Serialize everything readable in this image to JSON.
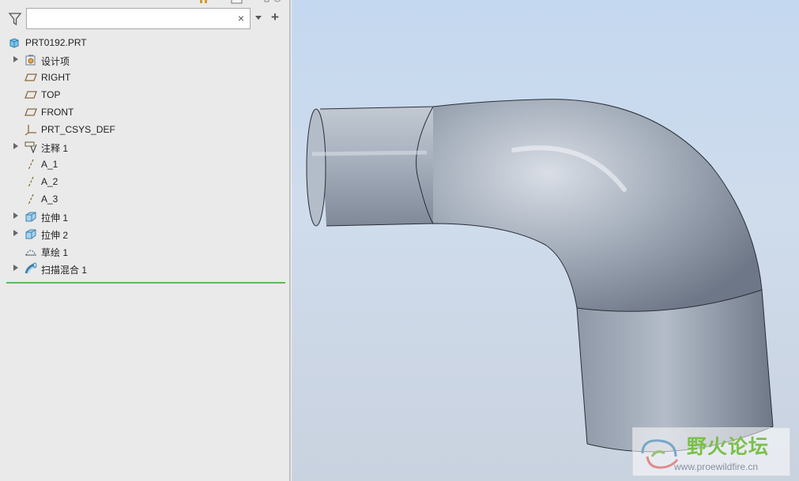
{
  "model_tree": {
    "search": {
      "value": "",
      "placeholder": ""
    },
    "items": [
      {
        "label": "PRT0192.PRT",
        "icon": "part-icon",
        "expandable": false
      },
      {
        "label": "设计项",
        "icon": "design-items-icon",
        "expandable": true
      },
      {
        "label": "RIGHT",
        "icon": "datum-plane-icon",
        "expandable": false
      },
      {
        "label": "TOP",
        "icon": "datum-plane-icon",
        "expandable": false
      },
      {
        "label": "FRONT",
        "icon": "datum-plane-icon",
        "expandable": false
      },
      {
        "label": "PRT_CSYS_DEF",
        "icon": "coordinate-system-icon",
        "expandable": false
      },
      {
        "label": "注释 1",
        "icon": "annotation-icon",
        "expandable": true
      },
      {
        "label": "A_1",
        "icon": "datum-axis-icon",
        "expandable": false
      },
      {
        "label": "A_2",
        "icon": "datum-axis-icon",
        "expandable": false
      },
      {
        "label": "A_3",
        "icon": "datum-axis-icon",
        "expandable": false
      },
      {
        "label": "拉伸 1",
        "icon": "extrude-icon",
        "expandable": true
      },
      {
        "label": "拉伸 2",
        "icon": "extrude-icon",
        "expandable": true
      },
      {
        "label": "草绘 1",
        "icon": "sketch-icon",
        "expandable": false
      },
      {
        "label": "扫描混合 1",
        "icon": "swept-blend-icon",
        "expandable": true
      }
    ]
  },
  "watermark": {
    "title": "野火论坛",
    "url": "www.proewildfire.cn"
  },
  "colors": {
    "viewport_top": "#c4d8ef",
    "viewport_bottom": "#c9d2df",
    "model": "#9ea8b6",
    "insert_line": "#5cb85c"
  }
}
